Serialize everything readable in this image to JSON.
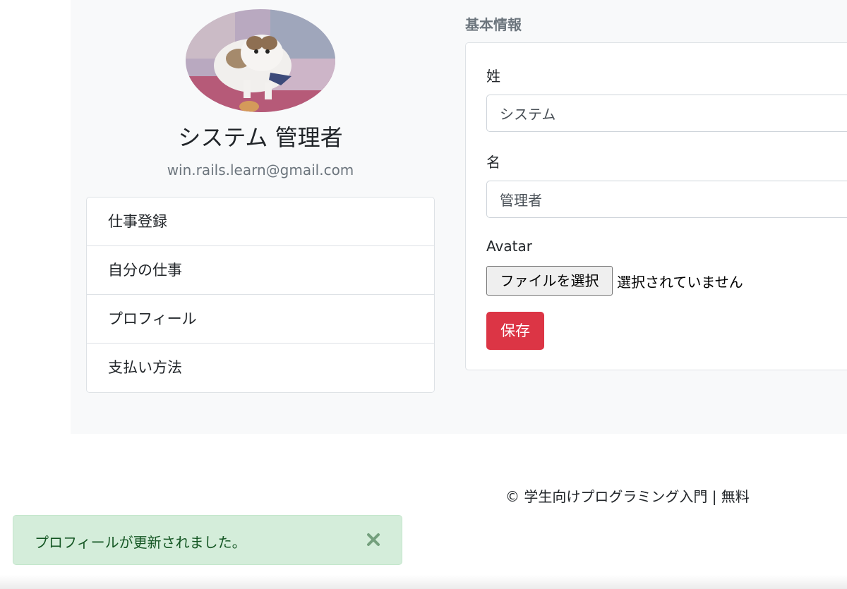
{
  "profile": {
    "name": "システム 管理者",
    "email": "win.rails.learn@gmail.com"
  },
  "menu": {
    "items": [
      {
        "label": "仕事登録"
      },
      {
        "label": "自分の仕事"
      },
      {
        "label": "プロフィール"
      },
      {
        "label": "支払い方法"
      }
    ]
  },
  "form": {
    "section_title": "基本情報",
    "last_name_label": "姓",
    "last_name_value": "システム",
    "first_name_label": "名",
    "first_name_value": "管理者",
    "avatar_label": "Avatar",
    "file_button_label": "ファイルを選択",
    "file_status": "選択されていません",
    "save_label": "保存"
  },
  "footer": {
    "text": "© 学生向けプログラミング入門 | 無料"
  },
  "alert": {
    "message": "プロフィールが更新されました。",
    "close_icon": "close-icon"
  },
  "colors": {
    "danger": "#dc3545",
    "success_bg": "#d4edda",
    "success_text": "#155724",
    "muted": "#6c757d"
  }
}
